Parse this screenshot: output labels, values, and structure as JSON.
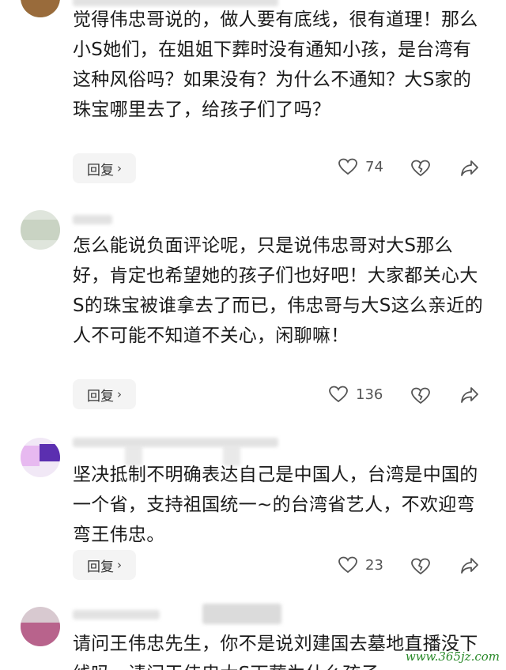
{
  "comments": [
    {
      "body": "觉得伟忠哥说的，做人要有底线，很有道理！那么小S她们，在姐姐下葬时没有通知小孩，是台湾有这种风俗吗？如果没有？为什么不通知？大S家的珠宝哪里去了，给孩子们了吗？",
      "reply_label": "回复",
      "likes": "74"
    },
    {
      "body": "怎么能说负面评论呢，只是说伟忠哥对大S那么好，肯定也希望她的孩子们也好吧！大家都关心大S的珠宝被谁拿去了而已，伟忠哥与大S这么亲近的人不可能不知道不关心，闲聊嘛！",
      "reply_label": "回复",
      "likes": "136"
    },
    {
      "body": "坚决抵制不明确表达自己是中国人，台湾是中国的一个省，支持祖国统一~的台湾省艺人，不欢迎弯弯王伟忠。",
      "reply_label": "回复",
      "likes": "23"
    },
    {
      "body": "请问王伟忠先生，你不是说刘建国去墓地直播没下线吗，请问王伟忠大S下葬为什么孩子"
    }
  ],
  "icons": {
    "like": "heart-outline-icon",
    "dislike": "broken-heart-icon",
    "share": "share-arrow-icon",
    "chevron": "chevron-right-icon"
  },
  "colors": {
    "reply_bg": "#f4f4f4",
    "icon_stroke": "#555555",
    "watermark": "#2b8a2b"
  },
  "watermark": "www.365jz.com"
}
